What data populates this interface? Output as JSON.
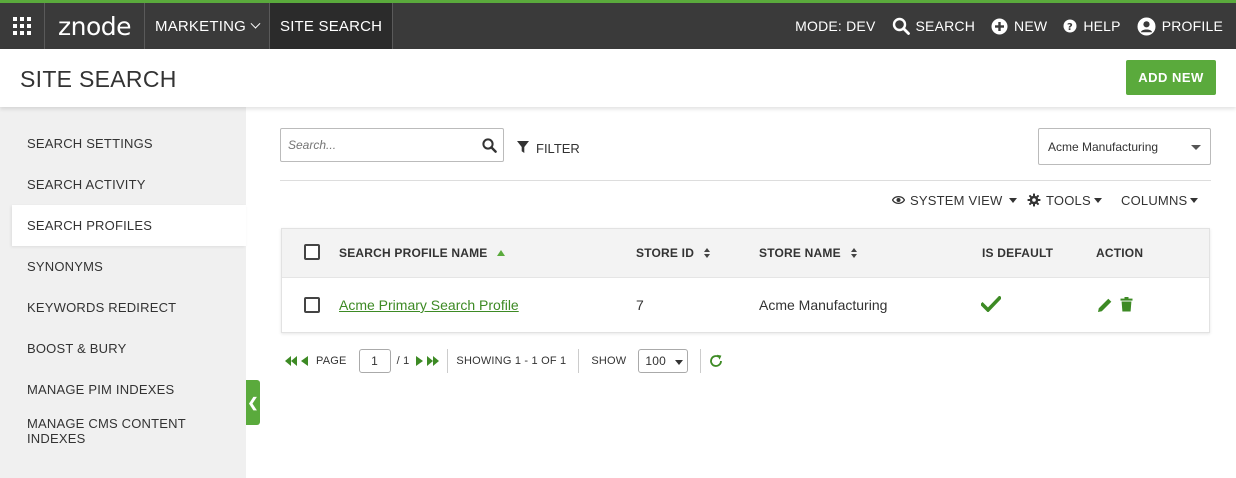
{
  "topnav": {
    "logo": "znode",
    "menus": [
      {
        "label": "MARKETING"
      },
      {
        "label": "SITE SEARCH"
      }
    ],
    "mode": "MODE: DEV",
    "search": "SEARCH",
    "new": "NEW",
    "help": "HELP",
    "profile": "PROFILE"
  },
  "header": {
    "title": "SITE SEARCH",
    "add_new": "ADD NEW"
  },
  "sidebar": {
    "items": [
      {
        "label": "SEARCH SETTINGS"
      },
      {
        "label": "SEARCH ACTIVITY"
      },
      {
        "label": "SEARCH PROFILES"
      },
      {
        "label": "SYNONYMS"
      },
      {
        "label": "KEYWORDS REDIRECT"
      },
      {
        "label": "BOOST & BURY"
      },
      {
        "label": "MANAGE PIM INDEXES"
      },
      {
        "label": "MANAGE CMS CONTENT INDEXES"
      }
    ],
    "collapse_glyph": "❮"
  },
  "filters": {
    "search_placeholder": "Search...",
    "filter_label": "FILTER",
    "store_selected": "Acme Manufacturing"
  },
  "toolbar": {
    "system_view": "SYSTEM VIEW",
    "tools": "TOOLS",
    "columns": "COLUMNS"
  },
  "grid": {
    "columns": [
      "SEARCH PROFILE NAME",
      "STORE ID",
      "STORE NAME",
      "IS DEFAULT",
      "ACTION"
    ],
    "rows": [
      {
        "name": "Acme Primary Search Profile",
        "store_id": "7",
        "store_name": "Acme Manufacturing"
      }
    ]
  },
  "pager": {
    "page_label": "PAGE",
    "page": "1",
    "of": "/ 1",
    "showing": "SHOWING 1 - 1 OF 1",
    "show_label": "SHOW",
    "page_size": "100"
  },
  "colors": {
    "brand_green": "#5aaa3c",
    "link_green": "#3d8a24",
    "topbar": "#3a3a3a"
  }
}
